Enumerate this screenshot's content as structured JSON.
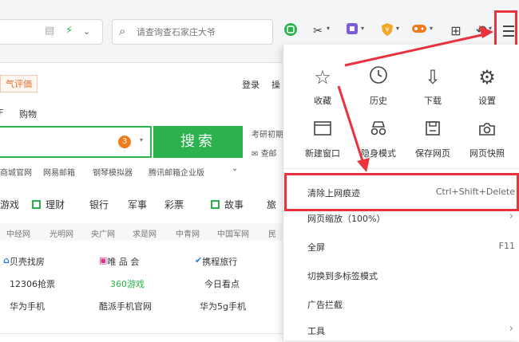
{
  "toolbar": {
    "search_placeholder": "请查询查石家庄大爷",
    "icons": [
      "translate-icon",
      "lightning-icon",
      "chevron-down-icon",
      "search-icon",
      "screenshot-icon",
      "scissors-icon",
      "extension-icon",
      "shield-icon",
      "game-icon",
      "grid-icon",
      "undo-icon",
      "menu-icon"
    ]
  },
  "page": {
    "weather_label": "气评価",
    "login": "登录",
    "login_more": "操",
    "nav_left": "F",
    "nav_shop": "购物",
    "search_badge": "3",
    "search_button": "搜索",
    "side_info_1": "考研初期",
    "side_info_2": "查邮",
    "email_links": [
      "商城官网",
      "网易邮箱",
      "钢琴模拟器",
      "腾讯邮箱企业版"
    ],
    "categories": [
      "游戏",
      "理财",
      "银行",
      "军事",
      "彩票",
      "故事",
      "旅"
    ],
    "media_links": [
      "中经网",
      "光明网",
      "央广网",
      "求是网",
      "中青网",
      "中国军网",
      "民"
    ],
    "sites": [
      {
        "label": "贝壳找房",
        "color": "#333"
      },
      {
        "label": "唯 品 会",
        "color": "#333"
      },
      {
        "label": "携程旅行",
        "color": "#333"
      },
      {
        "label": "12306抢票",
        "color": "#333"
      },
      {
        "label": "360游戏",
        "color": "#2bb24c"
      },
      {
        "label": "今日看点",
        "color": "#333"
      },
      {
        "label": "华为手机",
        "color": "#333"
      },
      {
        "label": "酷派手机官网",
        "color": "#333"
      },
      {
        "label": "华为5g手机",
        "color": "#333"
      }
    ]
  },
  "menu": {
    "grid": [
      {
        "icon": "star-icon",
        "label": "收藏"
      },
      {
        "icon": "history-icon",
        "label": "历史"
      },
      {
        "icon": "download-icon",
        "label": "下载"
      },
      {
        "icon": "gear-icon",
        "label": "设置"
      },
      {
        "icon": "new-window-icon",
        "label": "新建窗口"
      },
      {
        "icon": "incognito-icon",
        "label": "隐身模式"
      },
      {
        "icon": "save-icon",
        "label": "保存网页"
      },
      {
        "icon": "camera-icon",
        "label": "网页快照"
      }
    ],
    "clear_history": {
      "label": "清除上网痕迹",
      "shortcut": "Ctrl+Shift+Delete"
    },
    "zoom": "网页缩放（100%）",
    "fullscreen": {
      "label": "全屏",
      "shortcut": "F11"
    },
    "multi_tab": "切换到多标签模式",
    "adblock": "广告拦截",
    "tools": "工具"
  },
  "colors": {
    "accent_green": "#2bb24c",
    "highlight_red": "#e8323c",
    "badge_orange": "#f07b1a"
  }
}
